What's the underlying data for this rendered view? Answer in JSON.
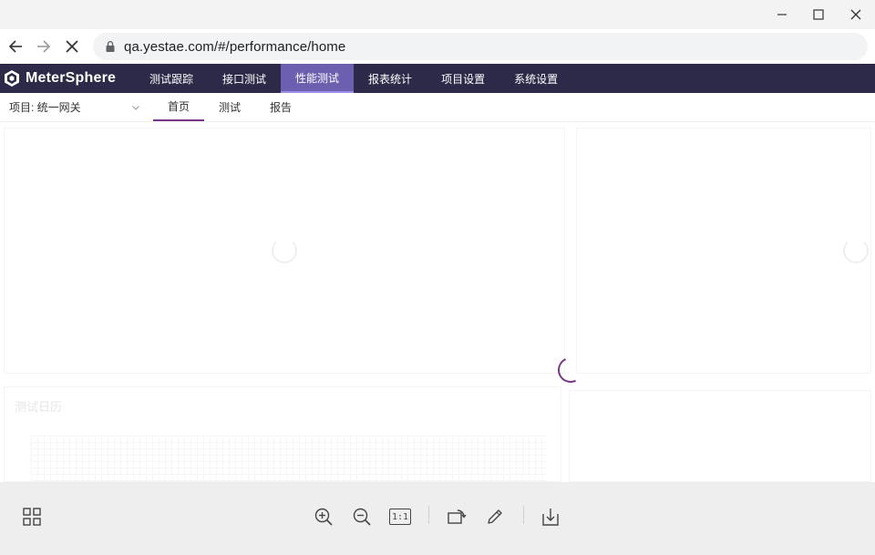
{
  "browser": {
    "url": "qa.yestae.com/#/performance/home"
  },
  "app": {
    "brand": "MeterSphere",
    "menu": [
      {
        "label": "测试跟踪"
      },
      {
        "label": "接口测试"
      },
      {
        "label": "性能测试",
        "active": true
      },
      {
        "label": "报表统计"
      },
      {
        "label": "项目设置"
      },
      {
        "label": "系统设置"
      }
    ],
    "accent_color": "#783887",
    "header_color": "#2c2a48"
  },
  "subnav": {
    "project": "项目: 统一网关",
    "tabs": [
      {
        "label": "首页",
        "active": true
      },
      {
        "label": "测试"
      },
      {
        "label": "报告"
      }
    ]
  },
  "content": {
    "calendar_title": "测试日历"
  },
  "toolbar": {
    "icons": [
      "grid-icon",
      "zoom-in-icon",
      "zoom-out-icon",
      "actual-size-icon",
      "rotate-icon",
      "edit-icon",
      "download-icon"
    ],
    "actual_size_label": "1:1"
  }
}
